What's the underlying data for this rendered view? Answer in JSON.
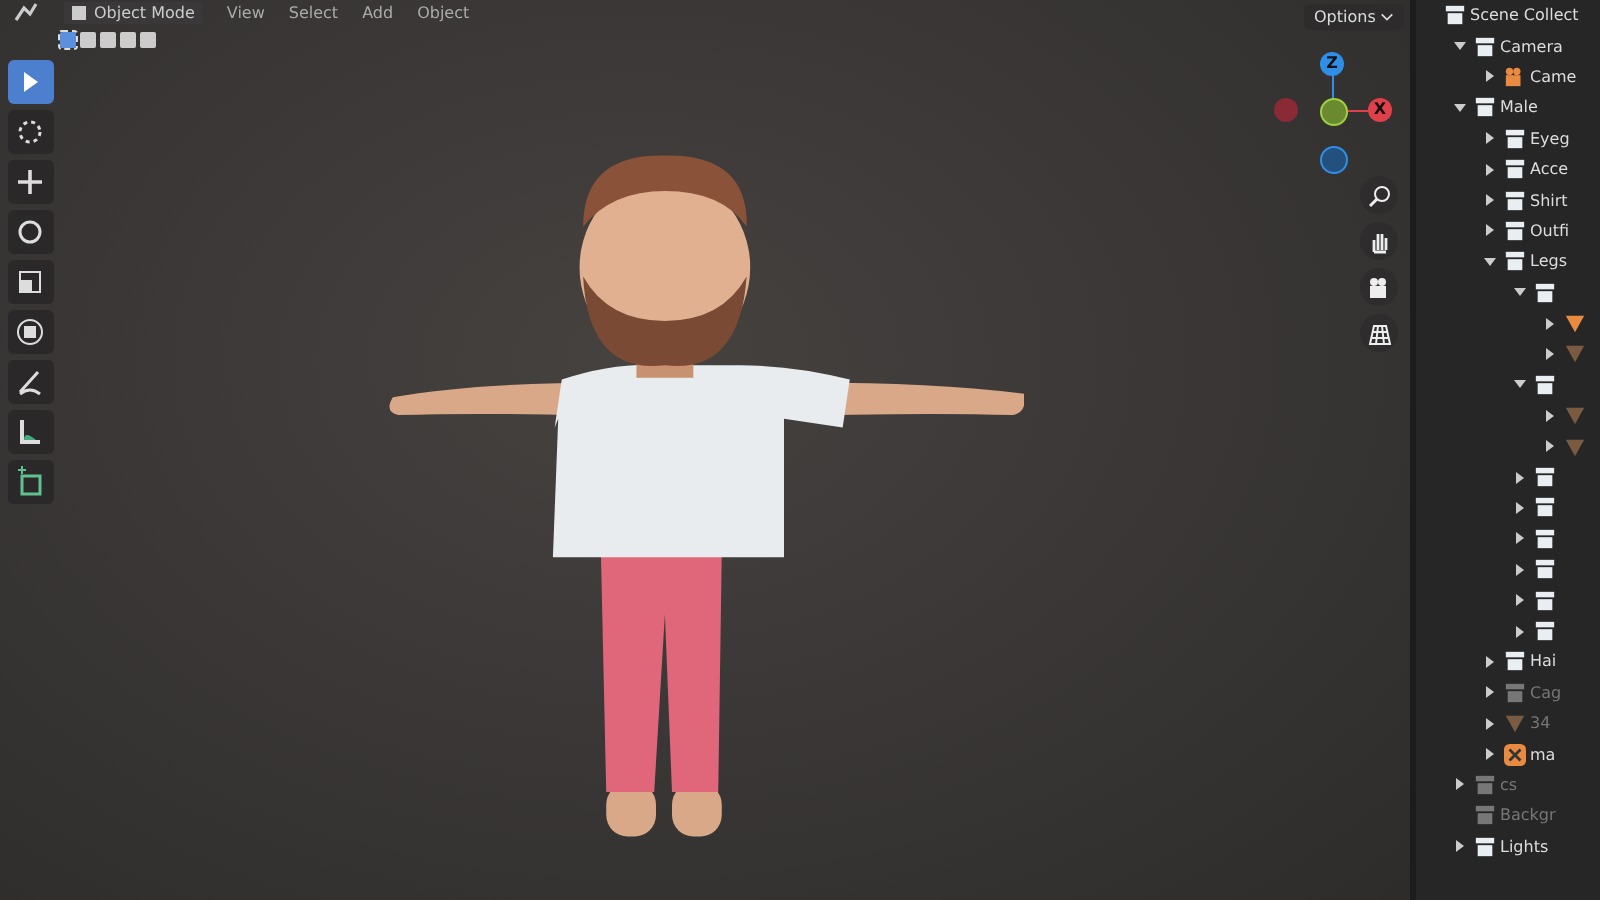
{
  "header": {
    "mode": "Object Mode",
    "menus": [
      "View",
      "Select",
      "Add",
      "Object"
    ]
  },
  "select_modes": [
    {
      "selected": true
    },
    {
      "selected": false
    },
    {
      "selected": false
    },
    {
      "selected": false
    },
    {
      "selected": false
    }
  ],
  "tools": [
    {
      "kind": "select",
      "selected": true
    },
    {
      "kind": "cursor",
      "selected": false
    },
    {
      "kind": "move",
      "selected": false
    },
    {
      "kind": "rotate",
      "selected": false
    },
    {
      "kind": "scale",
      "selected": false
    },
    {
      "kind": "transform",
      "selected": false
    },
    {
      "kind": "annotate",
      "selected": false
    },
    {
      "kind": "measure",
      "selected": false
    },
    {
      "kind": "add-cube",
      "selected": false
    }
  ],
  "options_button": "Options",
  "gizmo": {
    "z": "Z",
    "x": "X"
  },
  "nav_buttons": [
    {
      "kind": "zoom"
    },
    {
      "kind": "pan"
    },
    {
      "kind": "camera"
    },
    {
      "kind": "ortho"
    }
  ],
  "outliner": [
    {
      "label": "Scene Collect",
      "kind": "collection",
      "disabled": false,
      "children": [
        {
          "label": "Camera",
          "kind": "collection",
          "disabled": false,
          "expanded": true,
          "children": [
            {
              "label": "Came",
              "kind": "camera",
              "disabled": false,
              "expanded": false
            }
          ]
        },
        {
          "label": "Male",
          "kind": "collection",
          "disabled": false,
          "expanded": true,
          "children": [
            {
              "label": "Eyeg",
              "kind": "collection",
              "disabled": false,
              "expanded": false
            },
            {
              "label": "Acce",
              "kind": "collection",
              "disabled": false,
              "expanded": false
            },
            {
              "label": "Shirt",
              "kind": "collection",
              "disabled": false,
              "expanded": false
            },
            {
              "label": "Outfi",
              "kind": "collection",
              "disabled": false,
              "expanded": false
            },
            {
              "label": "Legs",
              "kind": "collection",
              "disabled": false,
              "expanded": true,
              "children": [
                {
                  "kind": "collection",
                  "disabled": false,
                  "expanded": true,
                  "children": [
                    {
                      "kind": "mesh",
                      "disabled": false,
                      "expanded": false
                    },
                    {
                      "kind": "mesh",
                      "disabled": true,
                      "expanded": false
                    }
                  ]
                },
                {
                  "kind": "collection",
                  "disabled": false,
                  "expanded": true,
                  "children": [
                    {
                      "kind": "mesh",
                      "disabled": true,
                      "expanded": false
                    },
                    {
                      "kind": "mesh",
                      "disabled": true,
                      "expanded": false
                    }
                  ]
                },
                {
                  "kind": "collection",
                  "disabled": false,
                  "expanded": false
                },
                {
                  "kind": "collection",
                  "disabled": false,
                  "expanded": false
                },
                {
                  "kind": "collection",
                  "disabled": false,
                  "expanded": false
                },
                {
                  "kind": "collection",
                  "disabled": false,
                  "expanded": false
                },
                {
                  "kind": "collection",
                  "disabled": false,
                  "expanded": false
                },
                {
                  "kind": "collection",
                  "disabled": false,
                  "expanded": false
                }
              ]
            },
            {
              "label": "Hai",
              "kind": "collection",
              "disabled": false,
              "expanded": false
            },
            {
              "label": "Cag",
              "kind": "collection",
              "disabled": true,
              "expanded": false
            },
            {
              "label": "34",
              "kind": "mesh",
              "disabled": true,
              "expanded": false
            },
            {
              "label": "ma",
              "kind": "armature",
              "disabled": false,
              "expanded": false
            }
          ]
        },
        {
          "label": "cs",
          "kind": "collection",
          "disabled": true,
          "expanded": false
        },
        {
          "label": "Backgr",
          "kind": "collection",
          "disabled": true
        },
        {
          "label": "Lights",
          "kind": "collection",
          "disabled": false,
          "expanded": false
        }
      ]
    }
  ]
}
